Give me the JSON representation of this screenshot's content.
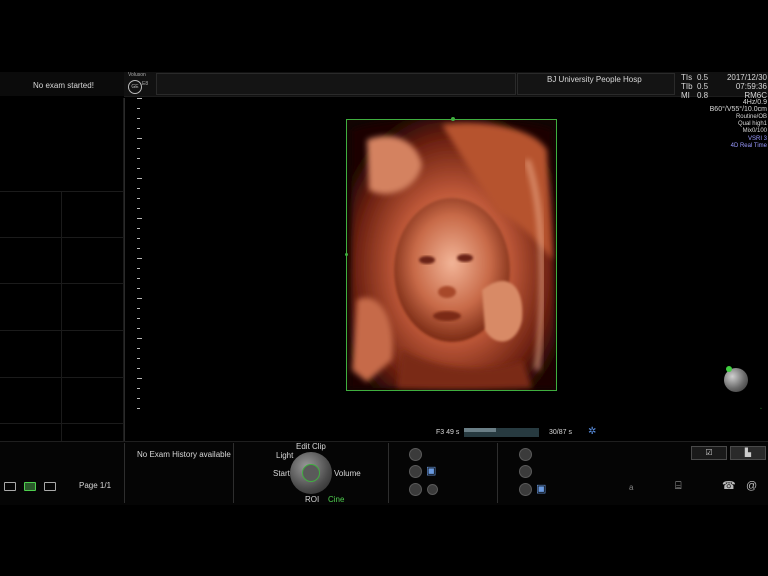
{
  "header": {
    "exam_status": "No exam started!",
    "brand": "Voluson",
    "brand_sub": "E8",
    "institution": "BJ  University  People Hosp",
    "tis_label": "TIs",
    "tis_value": "0.5",
    "tib_label": "TIb",
    "tib_value": "0.5",
    "mi_label": "MI",
    "mi_value": "0.8",
    "date": "2017/12/30",
    "time": "07:59:36"
  },
  "params": {
    "probe": "RM6C",
    "freq": "4Hz/0.9",
    "angle": "B60°/V55°/10.0cm",
    "preset": "Routine/OB",
    "quality": "Qual high1",
    "mix": "Mix0/100",
    "vsri": "VSRI 3",
    "mode": "4D Real Time"
  },
  "cine": {
    "left_label": "F3  49 s",
    "right_label": "30/87 s",
    "progress": 0.43
  },
  "bottom": {
    "history": "No Exam History available",
    "page": "Page 1/1",
    "clip_edit": "Edit Clip",
    "clip_light": "Light",
    "clip_start": "Start",
    "clip_volume": "Volume",
    "clip_roi": "ROI",
    "clip_cine": "Cine",
    "text_a": "a"
  },
  "colors": {
    "accent_green": "#3fae3f",
    "params_blue": "#9a9aff"
  }
}
